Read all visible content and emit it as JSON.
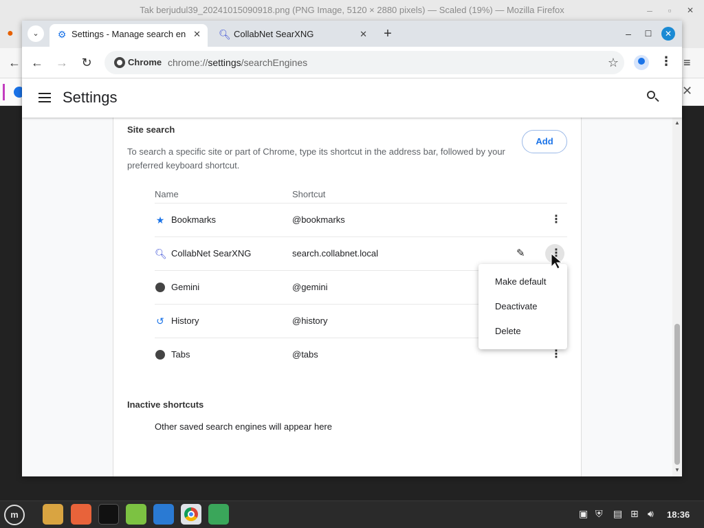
{
  "firefox": {
    "title": "Tak berjudul39_20241015090918.png (PNG Image, 5120 × 2880 pixels) — Scaled (19%) — Mozilla Firefox"
  },
  "chrome": {
    "tabs": [
      {
        "label": "Settings - Manage search en",
        "icon": "gear-icon",
        "active": true
      },
      {
        "label": "CollabNet SearXNG",
        "icon": "search-icon",
        "active": false
      }
    ],
    "omnibox": {
      "chip": "Chrome",
      "url_scheme": "chrome://",
      "url_host": "settings",
      "url_path": "/searchEngines"
    },
    "header_title": "Settings"
  },
  "site_search": {
    "title": "Site search",
    "description": "To search a specific site or part of Chrome, type its shortcut in the address bar, followed by your preferred keyboard shortcut.",
    "add_label": "Add",
    "columns": [
      "Name",
      "Shortcut"
    ],
    "rows": [
      {
        "name": "Bookmarks",
        "shortcut": "@bookmarks",
        "icon": "star-icon"
      },
      {
        "name": "CollabNet SearXNG",
        "shortcut": "search.collabnet.local",
        "icon": "search-icon"
      },
      {
        "name": "Gemini",
        "shortcut": "@gemini",
        "icon": "globe-icon"
      },
      {
        "name": "History",
        "shortcut": "@history",
        "icon": "history-icon"
      },
      {
        "name": "Tabs",
        "shortcut": "@tabs",
        "icon": "globe-icon"
      }
    ]
  },
  "context_menu": {
    "items": [
      "Make default",
      "Deactivate",
      "Delete"
    ]
  },
  "inactive": {
    "title": "Inactive shortcuts",
    "message": "Other saved search engines will appear here"
  },
  "taskbar": {
    "clock": "18:36"
  }
}
